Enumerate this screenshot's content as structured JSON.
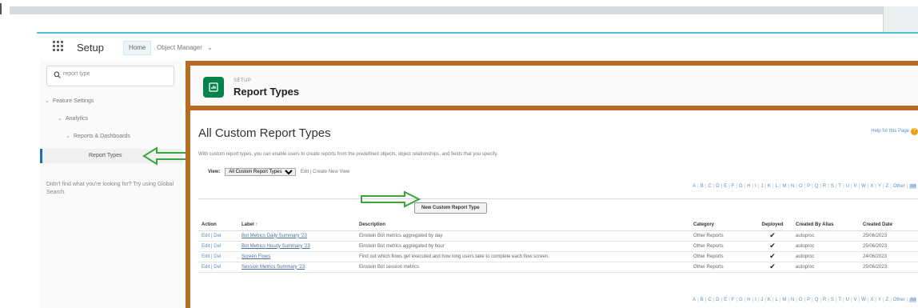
{
  "header": {
    "app_title": "Setup",
    "tabs": [
      {
        "label": "Home"
      },
      {
        "label": "Object Manager"
      }
    ]
  },
  "sidebar": {
    "search_value": "report type",
    "tree": [
      {
        "label": "Feature Settings"
      },
      {
        "label": "Analytics"
      },
      {
        "label": "Reports & Dashboards"
      }
    ],
    "selected_label": "Report Types",
    "hint": "Didn't find what you're looking for? Try using Global Search."
  },
  "page_header": {
    "subtitle": "SETUP",
    "title": "Report Types"
  },
  "main": {
    "heading": "All Custom Report Types",
    "help_link": "Help for this Page",
    "description": "With custom report types, you can enable users to create reports from the predefined objects, object relationships, and fields that you specify.",
    "view_label": "View:",
    "view_selected": "All Custom Report Types",
    "view_links": "Edit | Create New View",
    "alphabet": [
      "A",
      "B",
      "C",
      "D",
      "E",
      "F",
      "G",
      "H",
      "I",
      "J",
      "K",
      "L",
      "M",
      "N",
      "O",
      "P",
      "Q",
      "R",
      "S",
      "T",
      "U",
      "V",
      "W",
      "X",
      "Y",
      "Z",
      "Other",
      "All"
    ],
    "new_button": "New Custom Report Type",
    "table": {
      "columns": [
        "Action",
        "Label ↑",
        "Description",
        "Category",
        "Deployed",
        "Created By Alias",
        "Created Date"
      ],
      "rows": [
        {
          "action": "Edit | Del",
          "label": "Bot Metrics Daily Summary '23",
          "description": "Einstein Bot metrics aggregated by day",
          "category": "Other Reports",
          "deployed": "✔",
          "alias": "autoproc",
          "date": "25/06/2023"
        },
        {
          "action": "Edit | Del",
          "label": "Bot Metrics Hourly Summary '23",
          "description": "Einstein Bot metrics aggregated by hour",
          "category": "Other Reports",
          "deployed": "✔",
          "alias": "autoproc",
          "date": "25/06/2023"
        },
        {
          "action": "Edit | Del",
          "label": "Screen Flows",
          "description": "Find out which flows get executed and how long users take to complete each flow screen.",
          "category": "Other Reports",
          "deployed": "✔",
          "alias": "autoproc",
          "date": "24/06/2023"
        },
        {
          "action": "Edit | Del",
          "label": "Session Metrics Summary '23",
          "description": "Einstein Bot session metrics",
          "category": "Other Reports",
          "deployed": "✔",
          "alias": "autoproc",
          "date": "25/06/2023"
        }
      ]
    }
  },
  "colors": {
    "frame": "#b76b23",
    "accent_green": "#3aa63a",
    "header_icon": "#04844b",
    "top_border": "#4ac3d4"
  },
  "icons": [
    "app-launcher-icon",
    "search-icon",
    "chevron-down-icon",
    "report-types-icon",
    "help-icon",
    "arrow-annotation-icon"
  ]
}
